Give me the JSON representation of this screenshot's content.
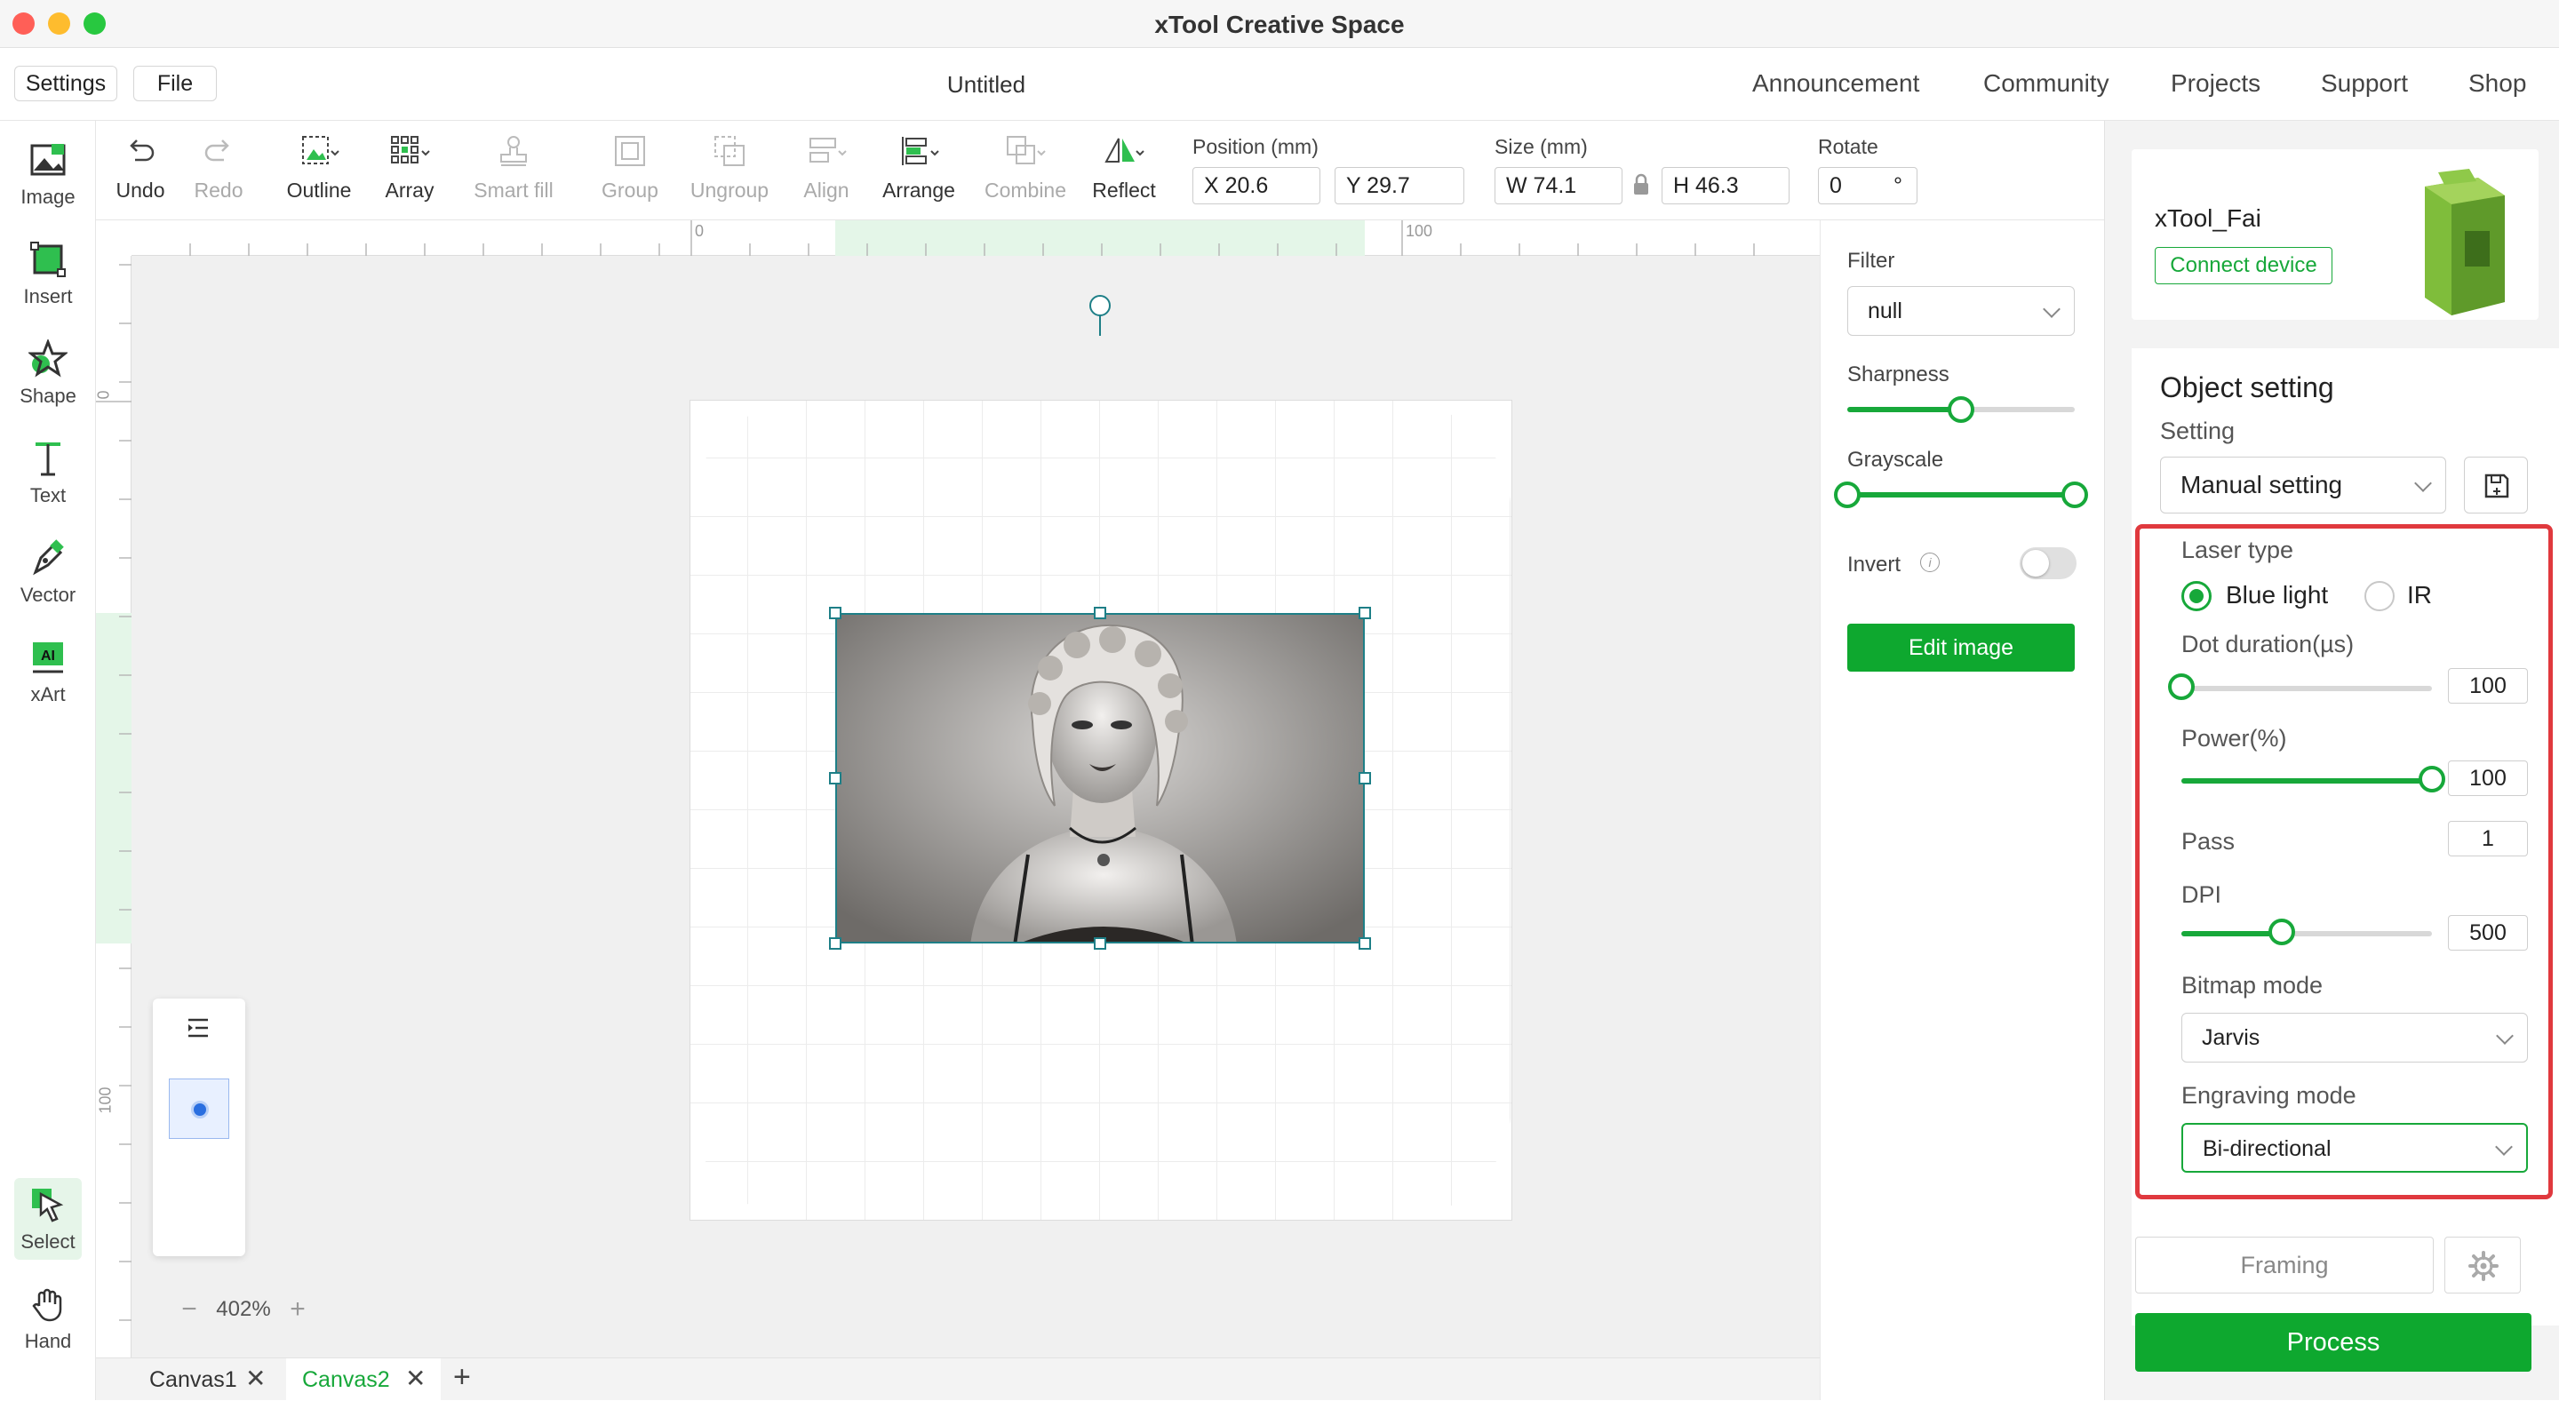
{
  "window": {
    "title": "xTool Creative Space"
  },
  "menubar": {
    "settings_label": "Settings",
    "file_label": "File",
    "doc_title": "Untitled",
    "nav": [
      "Announcement",
      "Community",
      "Projects",
      "Support",
      "Shop"
    ]
  },
  "left_tools": [
    "Image",
    "Insert",
    "Shape",
    "Text",
    "Vector",
    "xArt"
  ],
  "left_bottom_tools": [
    "Select",
    "Hand"
  ],
  "toolbar": {
    "undo": "Undo",
    "redo": "Redo",
    "outline": "Outline",
    "array": "Array",
    "smart_fill": "Smart fill",
    "group": "Group",
    "ungroup": "Ungroup",
    "align": "Align",
    "arrange": "Arrange",
    "combine": "Combine",
    "reflect": "Reflect",
    "position_label": "Position (mm)",
    "x_value": "X 20.6",
    "y_value": "Y 29.7",
    "size_label": "Size (mm)",
    "w_value": "W 74.1",
    "h_value": "H 46.3",
    "rotate_label": "Rotate",
    "rotate_value": "0",
    "rotate_unit": "°"
  },
  "ruler": {
    "top_ticks": [
      "0",
      "100"
    ],
    "left_ticks": [
      "0",
      "100"
    ]
  },
  "image_panel": {
    "filter_label": "Filter",
    "filter_value": "null",
    "sharpness_label": "Sharpness",
    "sharpness_level": 0.5,
    "grayscale_label": "Grayscale",
    "grayscale_range": [
      0,
      1
    ],
    "invert_label": "Invert",
    "invert_on": false,
    "edit_image_label": "Edit image"
  },
  "zoom": {
    "value": "402%",
    "minus": "−",
    "plus": "+"
  },
  "canvas_tabs": [
    {
      "label": "Canvas1",
      "active": false
    },
    {
      "label": "Canvas2",
      "active": true
    }
  ],
  "add_tab": "+",
  "device": {
    "name": "xTool_Fai",
    "connect_label": "Connect device"
  },
  "object_setting": {
    "title": "Object setting",
    "setting_label": "Setting",
    "setting_value": "Manual setting",
    "laser_type_label": "Laser type",
    "laser_options": [
      "Blue light",
      "IR"
    ],
    "laser_selected": "Blue light",
    "dot_duration_label": "Dot duration(µs)",
    "dot_duration_value": "100",
    "dot_duration_level": 0.0,
    "power_label": "Power(%)",
    "power_value": "100",
    "power_level": 1.0,
    "pass_label": "Pass",
    "pass_value": "1",
    "dpi_label": "DPI",
    "dpi_value": "500",
    "dpi_level": 0.4,
    "bitmap_mode_label": "Bitmap mode",
    "bitmap_mode_value": "Jarvis",
    "engraving_mode_label": "Engraving mode",
    "engraving_mode_value": "Bi-directional"
  },
  "actions": {
    "framing_label": "Framing",
    "process_label": "Process"
  },
  "colors": {
    "accent": "#17a83a",
    "highlight_border": "#e0393e",
    "selection": "#1e7f87"
  }
}
